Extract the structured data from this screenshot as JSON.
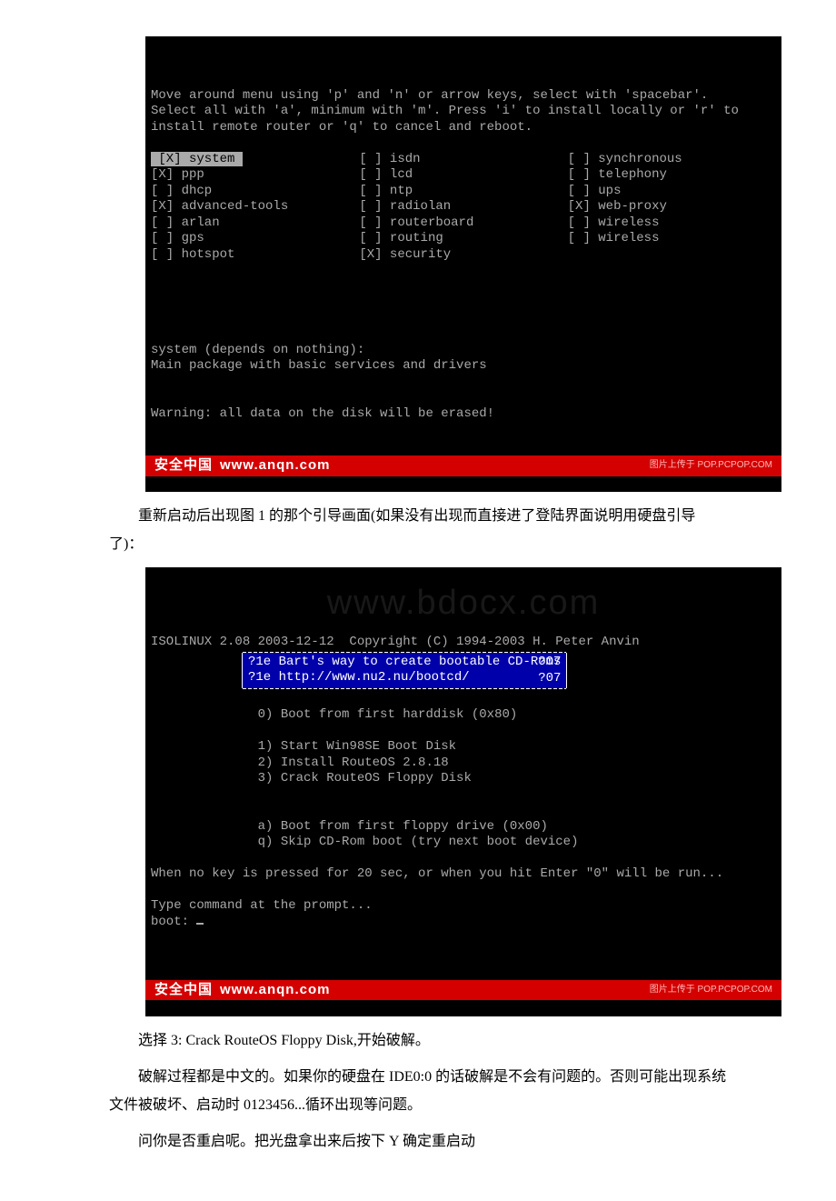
{
  "term1": {
    "instructions_l1": "Move around menu using 'p' and 'n' or arrow keys, select with 'spacebar'.",
    "instructions_l2": "Select all with 'a', minimum with 'm'. Press 'i' to install locally or 'r' to",
    "instructions_l3": "install remote router or 'q' to cancel and reboot.",
    "col1": {
      "i0": " [X] system ",
      "i1": "[X] ppp",
      "i2": "[ ] dhcp",
      "i3": "[X] advanced-tools",
      "i4": "[ ] arlan",
      "i5": "[ ] gps",
      "i6": "[ ] hotspot"
    },
    "col2": {
      "i0": "[ ] isdn",
      "i1": "[ ] lcd",
      "i2": "[ ] ntp",
      "i3": "[ ] radiolan",
      "i4": "[ ] routerboard",
      "i5": "[ ] routing",
      "i6": "[X] security"
    },
    "col3": {
      "i0": "[ ] synchronous",
      "i1": "[ ] telephony",
      "i2": "[ ] ups",
      "i3": "[X] web-proxy",
      "i4": "[ ] wireless",
      "i5": "[ ] wireless"
    },
    "depends": "system (depends on nothing):",
    "desc": "Main package with basic services and drivers",
    "warn": "Warning: all data on the disk will be erased!"
  },
  "term2": {
    "top": "ISOLINUX 2.08 2003-12-12  Copyright (C) 1994-2003 H. Peter Anvin",
    "box_l1": "?1e Bart's way to create bootable CD-Roms",
    "box_l1r": "?07",
    "box_l2": "?1e http://www.nu2.nu/bootcd/",
    "box_l2r": "?07",
    "m0": "0) Boot from first harddisk (0x80)",
    "m1": "1) Start Win98SE Boot Disk",
    "m2": "2) Install RouteOS 2.8.18",
    "m3": "3) Crack RouteOS Floppy Disk",
    "ma": "a) Boot from first floppy drive (0x00)",
    "mq": "q) Skip CD-Rom boot (try next boot device)",
    "hint": "When no key is pressed for 20 sec, or when you hit Enter \"0\" will be run...",
    "prompt1": "Type command at the prompt...",
    "prompt2": "boot: "
  },
  "footer": {
    "brand": "安全中国",
    "url": "www.anqn.com",
    "right": "图片上传于 POP.PCPOP.COM"
  },
  "watermark": "www.bdocx.com",
  "para1": "重新启动后出现图 1 的那个引导画面(如果没有出现而直接进了登陆界面说明用硬盘引导了)：",
  "para2": "选择 3: Crack RouteOS Floppy Disk,开始破解。",
  "para3": "破解过程都是中文的。如果你的硬盘在 IDE0:0 的话破解是不会有问题的。否则可能出现系统文件被破坏、启动时 0123456...循环出现等问题。",
  "para4": "问你是否重启呢。把光盘拿出来后按下 Y 确定重启动"
}
